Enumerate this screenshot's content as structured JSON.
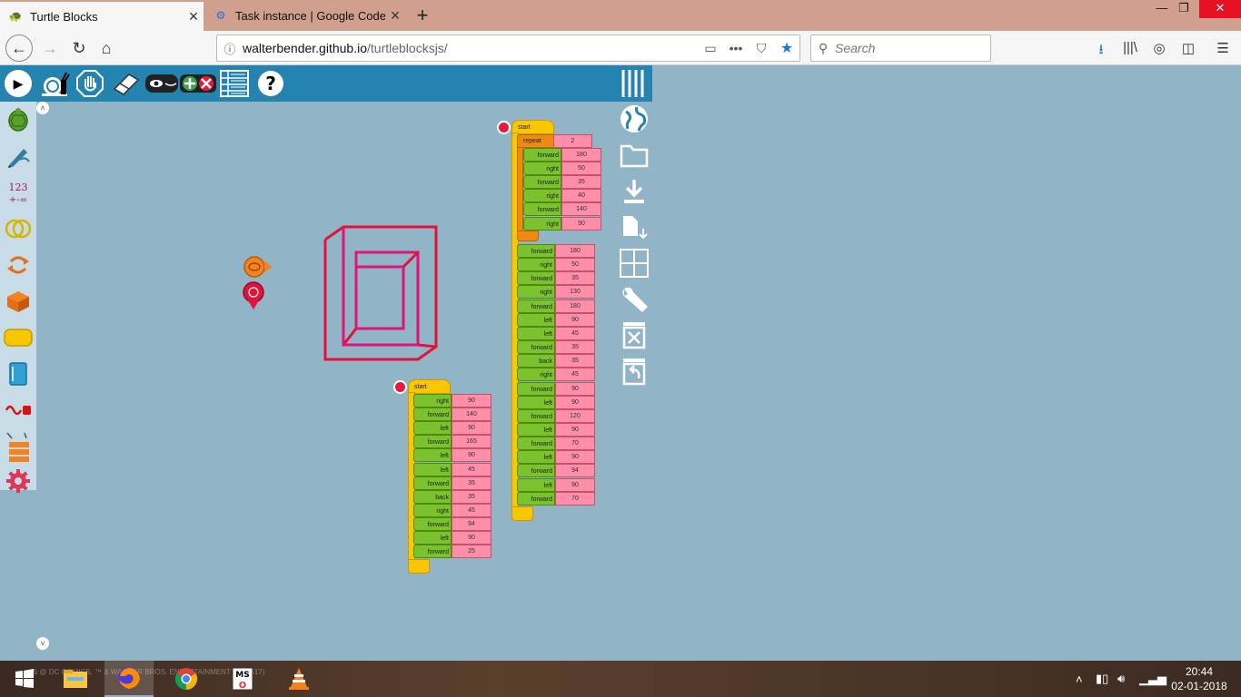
{
  "browser": {
    "tabs": [
      {
        "label": "Turtle Blocks",
        "active": true
      },
      {
        "label": "Task instance | Google Code-in",
        "active": false
      }
    ],
    "url_host": "walterbender.github.io",
    "url_path": "/turtleblocksjs/",
    "search_placeholder": "Search"
  },
  "blocks": {
    "stack1": {
      "start_label": "start",
      "rows": [
        {
          "cmd": "right",
          "val": "90"
        },
        {
          "cmd": "forward",
          "val": "140"
        },
        {
          "cmd": "left",
          "val": "90"
        },
        {
          "cmd": "forward",
          "val": "165"
        },
        {
          "cmd": "left",
          "val": "90"
        },
        {
          "cmd": "left",
          "val": "45"
        },
        {
          "cmd": "forward",
          "val": "35"
        },
        {
          "cmd": "back",
          "val": "35"
        },
        {
          "cmd": "right",
          "val": "45"
        },
        {
          "cmd": "forward",
          "val": "94"
        },
        {
          "cmd": "left",
          "val": "90"
        },
        {
          "cmd": "forward",
          "val": "25"
        }
      ]
    },
    "stack2": {
      "start_label": "start",
      "repeat_label": "repeat",
      "repeat_count": "2",
      "repeat_rows": [
        {
          "cmd": "forward",
          "val": "180"
        },
        {
          "cmd": "right",
          "val": "50"
        },
        {
          "cmd": "forward",
          "val": "35"
        },
        {
          "cmd": "right",
          "val": "40"
        },
        {
          "cmd": "forward",
          "val": "140"
        },
        {
          "cmd": "right",
          "val": "90"
        }
      ],
      "rows": [
        {
          "cmd": "forward",
          "val": "180"
        },
        {
          "cmd": "right",
          "val": "50"
        },
        {
          "cmd": "forward",
          "val": "35"
        },
        {
          "cmd": "right",
          "val": "130"
        },
        {
          "cmd": "forward",
          "val": "180"
        },
        {
          "cmd": "left",
          "val": "90"
        },
        {
          "cmd": "left",
          "val": "45"
        },
        {
          "cmd": "forward",
          "val": "35"
        },
        {
          "cmd": "back",
          "val": "35"
        },
        {
          "cmd": "right",
          "val": "45"
        },
        {
          "cmd": "forward",
          "val": "90"
        },
        {
          "cmd": "left",
          "val": "90"
        },
        {
          "cmd": "forward",
          "val": "120"
        },
        {
          "cmd": "left",
          "val": "90"
        },
        {
          "cmd": "forward",
          "val": "70"
        },
        {
          "cmd": "left",
          "val": "90"
        },
        {
          "cmd": "forward",
          "val": "94"
        },
        {
          "cmd": "left",
          "val": "90"
        },
        {
          "cmd": "forward",
          "val": "70"
        }
      ]
    }
  },
  "taskbar": {
    "clock_time": "20:44",
    "clock_date": "02-01-2018",
    "desktop_text": "& @ DC COMICS, ™ & WARNER BROS. ENTERTAINMENT INC (S17)"
  },
  "colors": {
    "toolbar": "#2584af",
    "canvas": "#91b4c7",
    "palette": "#c7dce6",
    "drawing_red": "#e3123a",
    "drawing_pink": "#e0157a",
    "block_green": "#7ac22e",
    "block_yellow": "#f9c700",
    "block_orange": "#ee8a12",
    "number_pink": "#ff8fa8"
  }
}
